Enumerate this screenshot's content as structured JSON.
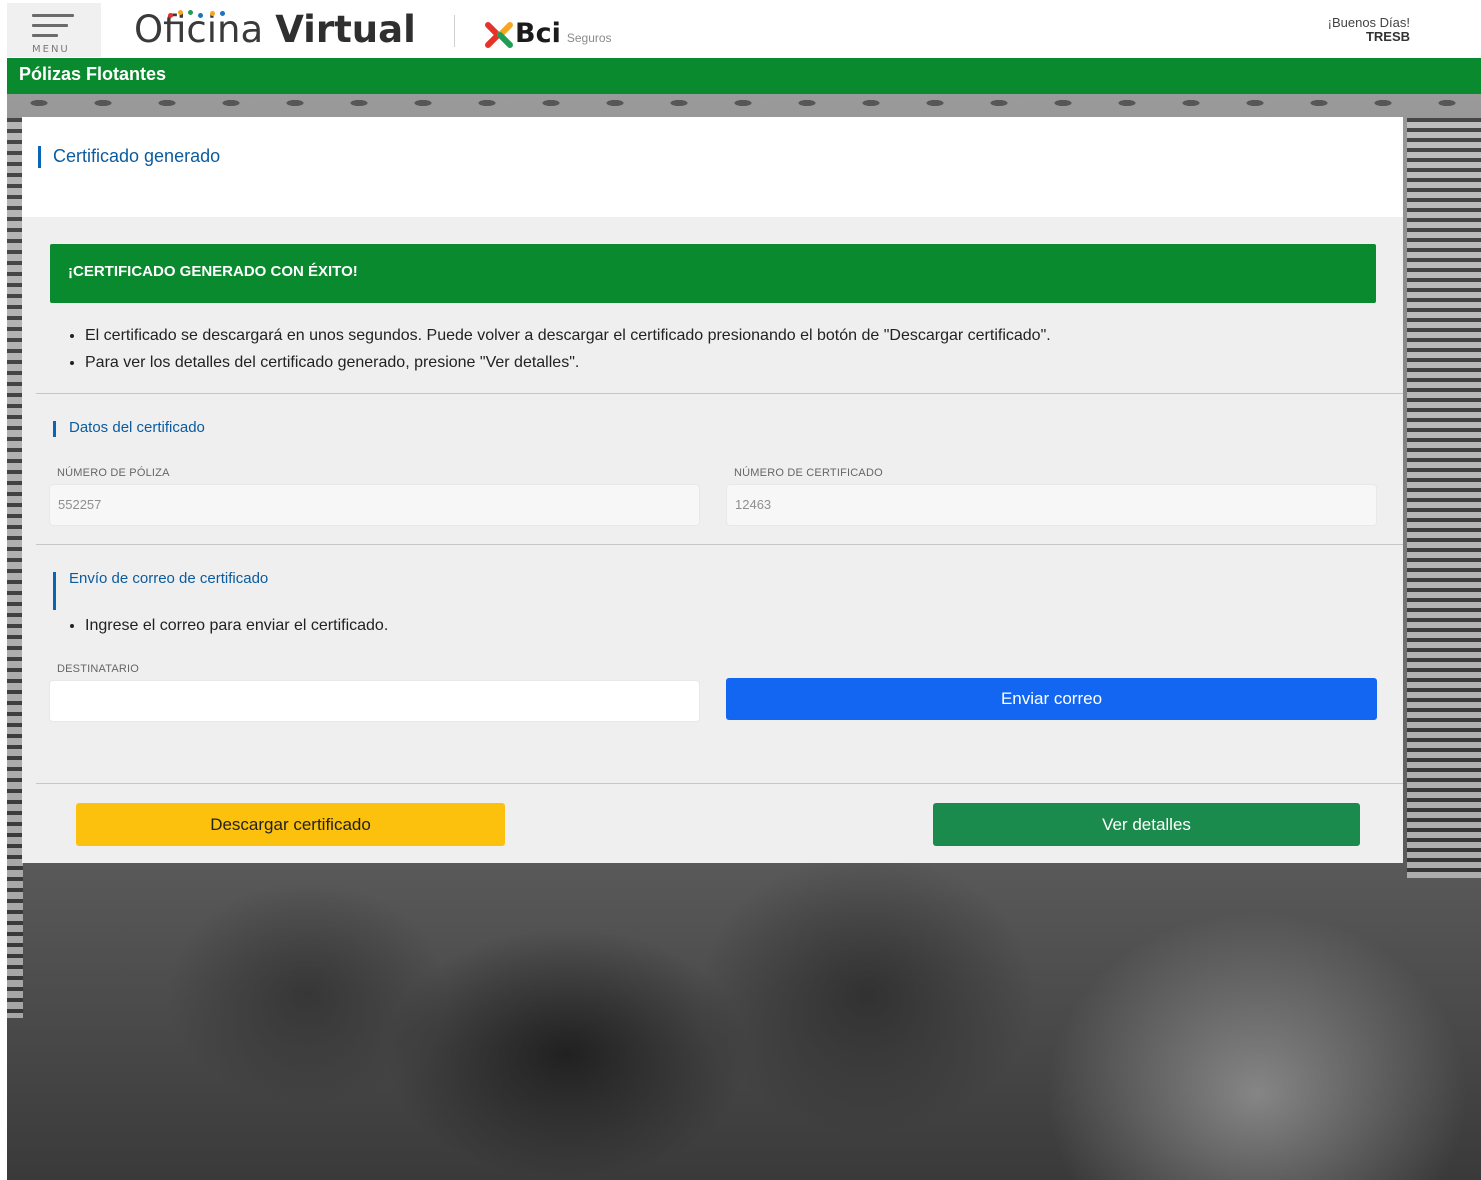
{
  "header": {
    "menu_label": "MENU",
    "brand_light": "Oficina",
    "brand_bold": "Virtual",
    "partner_name": "Bci",
    "partner_sub": "Seguros",
    "greeting": "¡Buenos Días!",
    "user": "TRESB"
  },
  "nav": {
    "section_title": "Pólizas Flotantes"
  },
  "card": {
    "title": "Certificado generado",
    "success_message": "¡CERTIFICADO GENERADO CON ÉXITO!",
    "info_items": [
      "El certificado se descargará en unos segundos. Puede volver a descargar el certificado presionando el botón de \"Descargar certificado\".",
      "Para ver los detalles del certificado generado, presione \"Ver detalles\"."
    ],
    "data_section": {
      "title": "Datos del certificado",
      "policy_label": "NÚMERO DE PÓLIZA",
      "policy_value": "552257",
      "certificate_label": "NÚMERO DE CERTIFICADO",
      "certificate_value": "12463"
    },
    "email_section": {
      "title": "Envío de correo de certificado",
      "instruction": "Ingrese el correo para enviar el certificado.",
      "recipient_label": "DESTINATARIO",
      "recipient_value": "",
      "send_button": "Enviar correo"
    },
    "download_button": "Descargar certificado",
    "details_button": "Ver detalles"
  },
  "colors": {
    "brand_green": "#0a8a2e",
    "accent_blue": "#0a66b5",
    "send_blue": "#1266f1",
    "download_yellow": "#fcc10d",
    "details_green": "#1b8b4d"
  },
  "icons": {
    "menu": "hamburger-menu-icon",
    "partner_logo": "bci-x-logo-icon"
  }
}
